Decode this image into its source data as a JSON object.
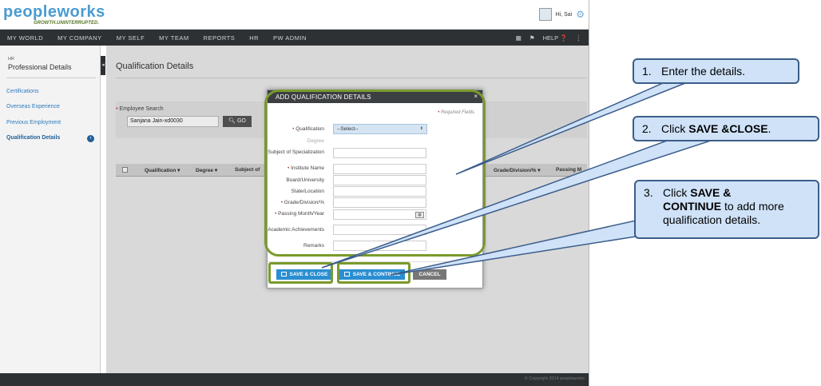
{
  "app": {
    "logo_main": "peopleworks",
    "logo_tagline": "GROWTH.UNINTERRUPTED.",
    "greeting": "Hi, Sai",
    "menu": [
      "MY WORLD",
      "MY COMPANY",
      "MY SELF",
      "MY TEAM",
      "REPORTS",
      "HR",
      "PW ADMIN"
    ],
    "help_label": "HELP",
    "footer_text": "© Copyright 2014 peopleworks"
  },
  "sidebar": {
    "module_label": "HR",
    "section_title": "Professional Details",
    "items": [
      {
        "label": "Certifications"
      },
      {
        "label": "Overseas Experience"
      },
      {
        "label": "Previous Employment"
      },
      {
        "label": "Qualification Details"
      }
    ]
  },
  "page": {
    "title": "Qualification Details",
    "search_label": "Employee Search",
    "search_value": "Sanjana Jain-xd0030",
    "go_label": "GO",
    "columns": [
      "Qualification",
      "Degree",
      "Subject of",
      "Grade/Division/%",
      "Passing M"
    ]
  },
  "modal": {
    "title": "ADD QUALIFICATION DETAILS",
    "required_note": "Required Fields",
    "select_placeholder": "--Select--",
    "fields": {
      "qualification": "Qualification",
      "degree": "Degree",
      "subject": "Subject of Specialization",
      "institute": "Institute Name",
      "board": "Board/University",
      "state": "State/Location",
      "grade": "Grade/Division/%",
      "passing": "Passing Month/Year",
      "academic": "Academic Achievements",
      "remarks": "Remarks"
    },
    "buttons": {
      "save_close": "SAVE & CLOSE",
      "save_continue": "SAVE & CONTINUE",
      "cancel": "CANCEL"
    }
  },
  "callouts": {
    "c1_num": "1.",
    "c1_text": "Enter the details.",
    "c2_num": "2.",
    "c2_prefix": "Click ",
    "c2_bold": "SAVE &CLOSE",
    "c2_suffix": ".",
    "c3_num": "3.",
    "c3_prefix": "Click ",
    "c3_bold_1": "SAVE &",
    "c3_bold_2": "CONTINUE",
    "c3_suffix": " to add more",
    "c3_line3": "qualification details."
  },
  "colors": {
    "highlight": "#7a9a2d",
    "callout_fill": "#cfe2f8",
    "callout_border": "#3c5d8a",
    "button_blue": "#2a8ed1"
  }
}
